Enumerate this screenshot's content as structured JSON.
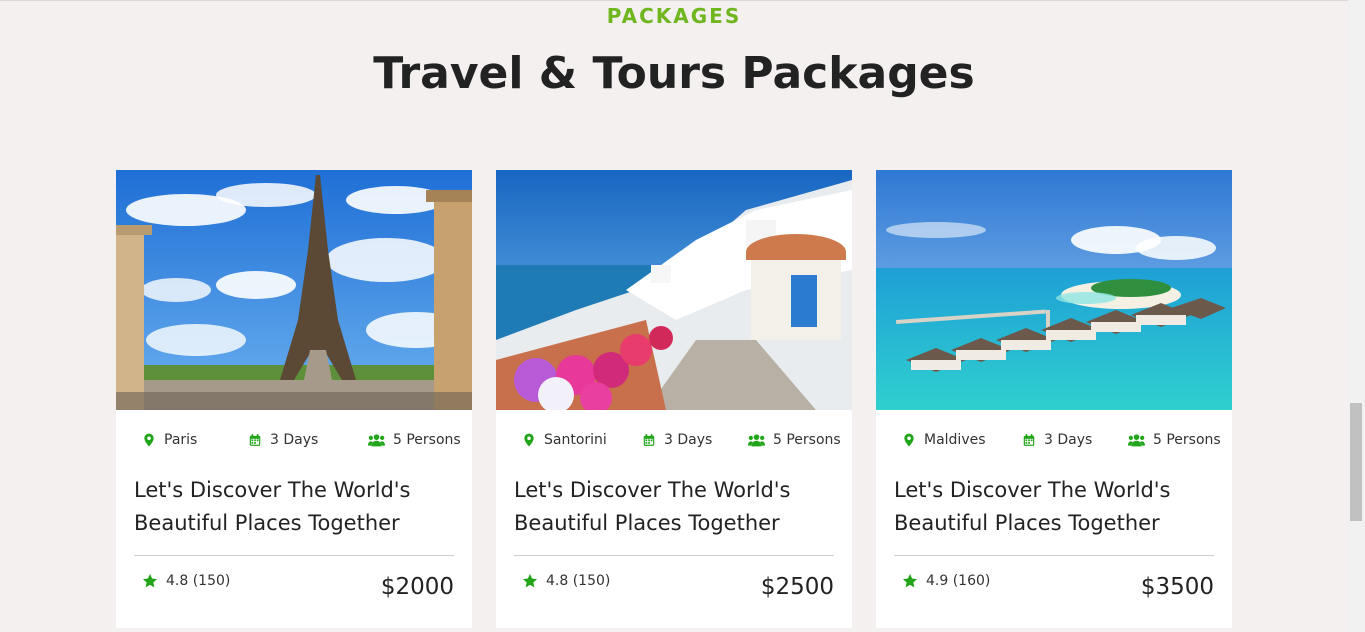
{
  "section": {
    "eyebrow": "PACKAGES",
    "heading": "Travel & Tours Packages"
  },
  "accent_color": "#22a51a",
  "cards": [
    {
      "image_label": "Eiffel Tower, Paris",
      "location": "Paris",
      "duration": "3 Days",
      "persons": "5 Persons",
      "title_line1": "Let's Discover The World's",
      "title_line2": "Beautiful Places Together",
      "rating": "4.8 (150)",
      "price": "$2000"
    },
    {
      "image_label": "Santorini village",
      "location": "Santorini",
      "duration": "3 Days",
      "persons": "5 Persons",
      "title_line1": "Let's Discover The World's",
      "title_line2": "Beautiful Places Together",
      "rating": "4.8 (150)",
      "price": "$2500"
    },
    {
      "image_label": "Maldives water villas",
      "location": "Maldives",
      "duration": "3 Days",
      "persons": "5 Persons",
      "title_line1": "Let's Discover The World's",
      "title_line2": "Beautiful Places Together",
      "rating": "4.9 (160)",
      "price": "$3500"
    }
  ]
}
